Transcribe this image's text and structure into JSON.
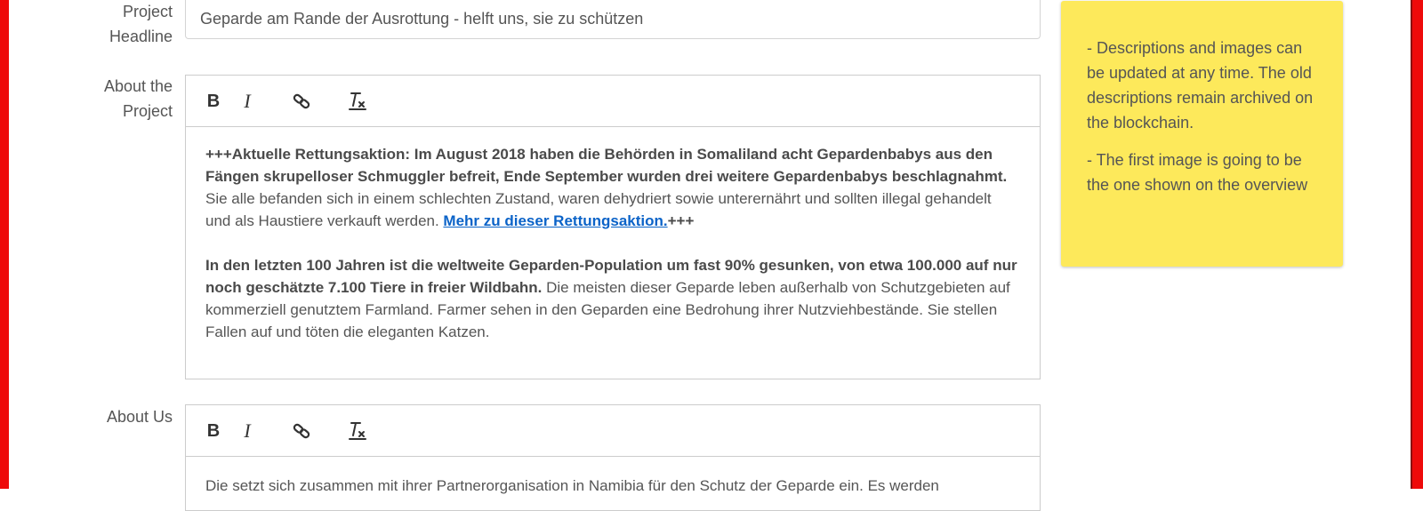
{
  "form": {
    "headline": {
      "label_line1": "Project",
      "label_line2": "Headline",
      "value": "Geparde am Rande der Ausrottung - helft uns, sie zu schützen"
    },
    "about_project": {
      "label_line1": "About the",
      "label_line2": "Project",
      "toolbar": {
        "bold": "B",
        "italic": "I"
      },
      "paragraph1": {
        "bold": "+++Aktuelle Rettungsaktion: Im August 2018 haben die Behörden in Somaliland acht Gepardenbabys aus den Fängen skrupelloser Schmuggler befreit, Ende September wurden drei weitere Gepardenbabys beschlagnahmt.",
        "normal": " Sie alle befanden sich in einem schlechten Zustand, waren dehydriert sowie unterernährt und sollten illegal gehandelt und als Haustiere verkauft werden. ",
        "link": "Mehr zu dieser Rettungsaktion.",
        "suffix": "+++"
      },
      "paragraph2": {
        "bold": "In den letzten 100 Jahren ist die weltweite Geparden-Population um fast 90% gesunken, von etwa 100.000 auf nur noch geschätzte 7.100 Tiere in freier Wildbahn.",
        "normal": " Die meisten dieser Geparde leben außerhalb von Schutzgebieten auf kommerziell genutztem Farmland. Farmer sehen in den Geparden eine Bedrohung ihrer Nutzviehbestände. Sie stellen Fallen auf und töten die eleganten Katzen."
      }
    },
    "about_us": {
      "label": "About Us",
      "toolbar": {
        "bold": "B",
        "italic": "I"
      },
      "paragraph1": "Die setzt sich zusammen mit ihrer Partnerorganisation in Namibia für den Schutz der Geparde ein. Es werden"
    }
  },
  "note": {
    "items": [
      "- Descriptions and images can be updated at any time. The old descriptions remain archived on the blockchain.",
      "- The first image is going to be the one shown on the overview"
    ]
  },
  "colors": {
    "frame": "#ee0a0a",
    "note_background": "#fde95b",
    "link": "#0b63c8"
  },
  "icons": [
    "bold-icon",
    "italic-icon",
    "link-icon",
    "clear-format-icon"
  ]
}
